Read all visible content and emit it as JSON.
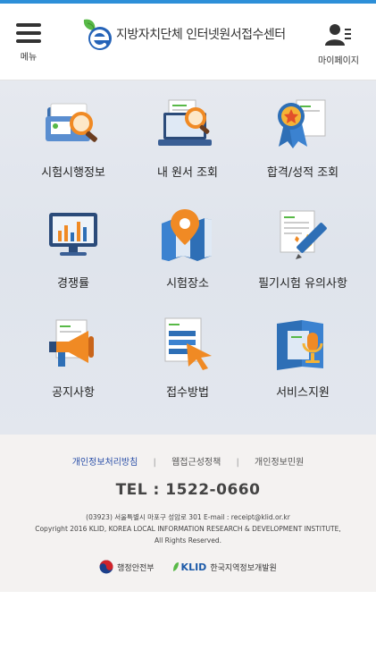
{
  "header": {
    "menu_label": "메뉴",
    "site_title": "지방자치단체 인터넷원서접수센터",
    "mypage_label": "마이페이지"
  },
  "menu_tiles": [
    {
      "label": "시험시행정보",
      "icon": "folder-search-icon"
    },
    {
      "label": "내 원서 조회",
      "icon": "laptop-search-icon"
    },
    {
      "label": "합격/성적 조회",
      "icon": "award-ribbon-icon"
    },
    {
      "label": "경쟁률",
      "icon": "bar-chart-monitor-icon"
    },
    {
      "label": "시험장소",
      "icon": "map-pin-icon"
    },
    {
      "label": "필기시험 유의사항",
      "icon": "document-pencil-icon"
    },
    {
      "label": "공지사항",
      "icon": "megaphone-icon"
    },
    {
      "label": "접수방법",
      "icon": "form-cursor-icon"
    },
    {
      "label": "서비스지원",
      "icon": "book-microphone-icon"
    }
  ],
  "footer": {
    "links": [
      "개인정보처리방침",
      "웹접근성정책",
      "개인정보민원"
    ],
    "tel": "TEL : 1522-0660",
    "address": "(03923) 서울특별시 마포구 성암로 301    E-mail : receipt@klid.or.kr",
    "copyright_1": "Copyright 2016 KLID, KOREA LOCAL INFORMATION RESEARCH & DEVELOPMENT INSTITUTE,",
    "copyright_2": "All Rights Reserved.",
    "partner_1": "행정안전부",
    "partner_2_logo": "KLID",
    "partner_2": "한국지역정보개발원"
  },
  "colors": {
    "accent": "#2d8fd8",
    "link_active": "#2a4fa8",
    "icon_orange": "#f08a24",
    "icon_blue": "#2e6fb6"
  }
}
